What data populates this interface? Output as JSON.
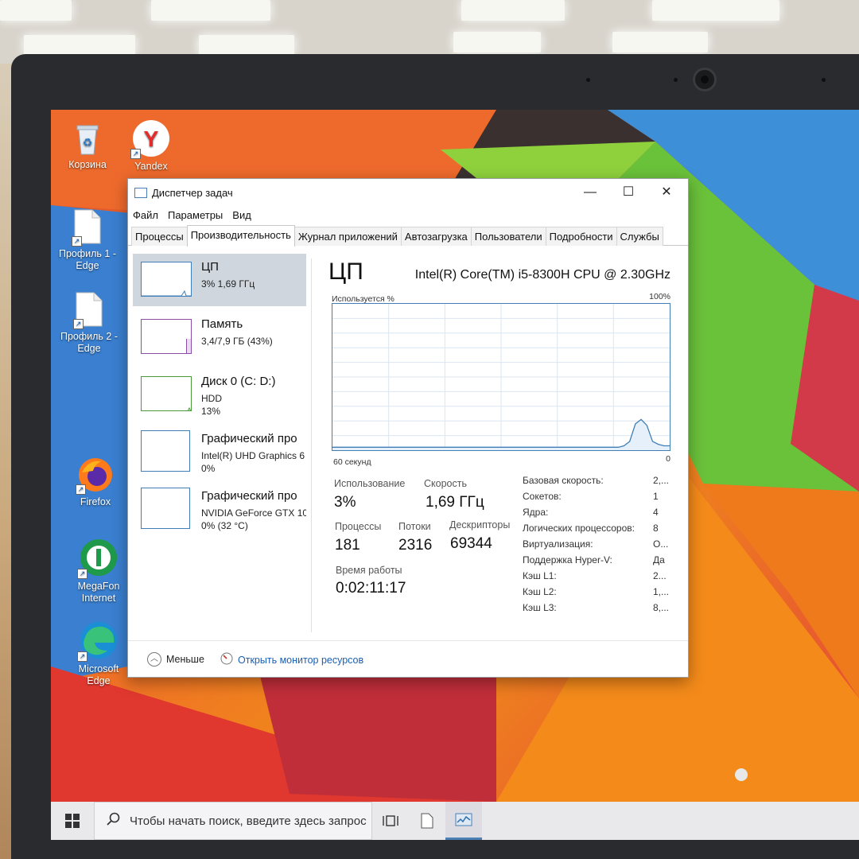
{
  "desktop": {
    "icons": [
      {
        "label": "Корзина",
        "icon": "recycle-bin-icon"
      },
      {
        "label": "Yandex",
        "icon": "yandex-browser-icon"
      },
      {
        "label": "Профиль 1 - Edge",
        "icon": "file-shortcut-icon"
      },
      {
        "label": "Профиль 2 - Edge",
        "icon": "file-shortcut-icon"
      },
      {
        "label": "Firefox",
        "icon": "firefox-icon"
      },
      {
        "label": "MegaFon Internet",
        "icon": "megafon-icon"
      },
      {
        "label": "Microsoft Edge",
        "icon": "edge-icon"
      }
    ]
  },
  "window": {
    "title": "Диспетчер задач",
    "controls": {
      "minimize": "—",
      "maximize": "☐",
      "close": "✕"
    }
  },
  "menu": [
    "Файл",
    "Параметры",
    "Вид"
  ],
  "tabs": [
    "Процессы",
    "Производительность",
    "Журнал приложений",
    "Автозагрузка",
    "Пользователи",
    "Подробности",
    "Службы"
  ],
  "active_tab": "Производительность",
  "resources": [
    {
      "title": "ЦП",
      "line1": "3% 1,69 ГГц",
      "line2": "",
      "selected": true
    },
    {
      "title": "Память",
      "line1": "3,4/7,9 ГБ (43%)",
      "line2": "",
      "memory_used_fraction": 0.43
    },
    {
      "title": "Диск 0 (C: D:)",
      "line1": "HDD",
      "line2": "13%"
    },
    {
      "title": "Графический про",
      "line1": "Intel(R) UHD Graphics 6",
      "line2": "0%"
    },
    {
      "title": "Графический про",
      "line1": "NVIDIA GeForce GTX 10",
      "line2": "0% (32 °C)"
    }
  ],
  "detail": {
    "heading": "ЦП",
    "model": "Intel(R) Core(TM) i5-8300H CPU @ 2.30GHz",
    "graph_label": "Используется %",
    "graph_max": "100%",
    "graph_time": "60 секунд",
    "graph_min": "0",
    "cpu_usage_history": [
      2,
      2,
      2,
      2,
      2,
      2,
      2,
      2,
      2,
      2,
      2,
      2,
      2,
      2,
      2,
      2,
      2,
      2,
      2,
      2,
      2,
      2,
      2,
      2,
      2,
      2,
      2,
      2,
      2,
      2,
      2,
      2,
      2,
      2,
      2,
      2,
      2,
      2,
      2,
      2,
      2,
      2,
      2,
      2,
      2,
      2,
      2,
      2,
      2,
      2,
      2,
      3,
      6,
      18,
      21,
      17,
      6,
      4,
      3,
      3
    ],
    "stats": {
      "usage_label": "Использование",
      "usage": "3%",
      "speed_label": "Скорость",
      "speed": "1,69 ГГц",
      "processes_label": "Процессы",
      "processes": "181",
      "threads_label": "Потоки",
      "threads": "2316",
      "handles_label": "Дескрипторы",
      "handles": "69344",
      "uptime_label": "Время работы",
      "uptime": "0:02:11:17"
    },
    "specs": [
      {
        "k": "Базовая скорость:",
        "v": "2,..."
      },
      {
        "k": "Сокетов:",
        "v": "1"
      },
      {
        "k": "Ядра:",
        "v": "4"
      },
      {
        "k": "Логических процессоров:",
        "v": "8"
      },
      {
        "k": "Виртуализация:",
        "v": "О..."
      },
      {
        "k": "Поддержка Hyper-V:",
        "v": "Да"
      },
      {
        "k": "Кэш L1:",
        "v": "2..."
      },
      {
        "k": "Кэш L2:",
        "v": "1,..."
      },
      {
        "k": "Кэш L3:",
        "v": "8,..."
      }
    ]
  },
  "footer": {
    "less": "Меньше",
    "monitor": "Открыть монитор ресурсов"
  },
  "taskbar": {
    "search_placeholder": "Чтобы начать поиск, введите здесь запрос"
  },
  "colors": {
    "cpu_accent": "#3f7fb5",
    "memory_accent": "#8a4ea6",
    "disk_accent": "#4a9a3a",
    "link": "#1a5fb4"
  }
}
